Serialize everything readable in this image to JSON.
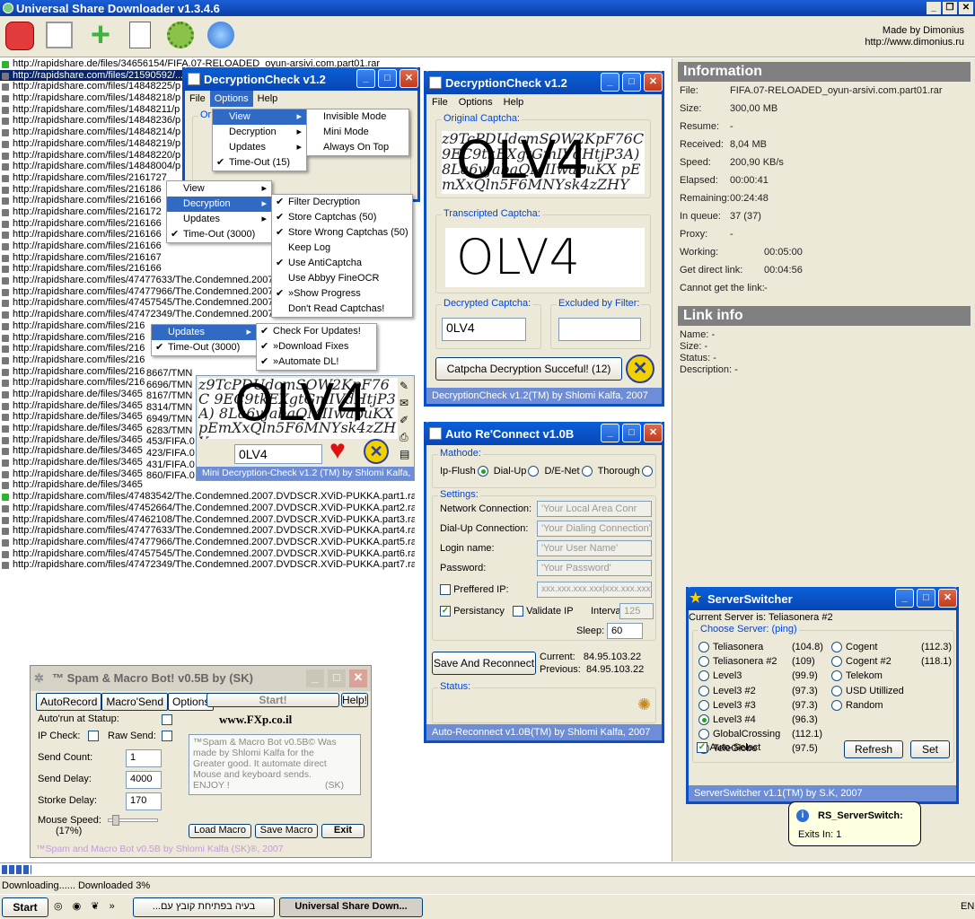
{
  "app": {
    "title": "Universal Share Downloader v1.3.4.6",
    "made_by": "Made by Dimonius",
    "url": "http://www.dimonius.ru"
  },
  "toolbar": {
    "icons": [
      "stop-icon",
      "window-icon",
      "add-icon",
      "document-icon",
      "gear-icon",
      "globe-icon"
    ]
  },
  "list": {
    "rows": [
      "http://rapidshare.de/files/34656154/FIFA.07-RELOADED_oyun-arsivi.com.part01.rar",
      "http://rapidshare.com/files/21590592/...",
      "http://rapidshare.com/files/14848225/p",
      "http://rapidshare.com/files/14848218/p",
      "http://rapidshare.com/files/14848211/p",
      "http://rapidshare.com/files/14848236/p",
      "http://rapidshare.com/files/14848214/p",
      "http://rapidshare.com/files/14848219/p",
      "http://rapidshare.com/files/14848220/p",
      "http://rapidshare.com/files/14848004/p",
      "http://rapidshare.com/files/2161727",
      "http://rapidshare.com/files/216186",
      "http://rapidshare.com/files/216166",
      "http://rapidshare.com/files/216172",
      "http://rapidshare.com/files/216166",
      "http://rapidshare.com/files/216166",
      "http://rapidshare.com/files/216166",
      "http://rapidshare.com/files/216167",
      "http://rapidshare.com/files/216166",
      "http://rapidshare.com/files/47477633/The.Condemned.2007.",
      "http://rapidshare.com/files/47477966/The.Condemned.2007.",
      "http://rapidshare.com/files/47457545/The.Condemned.2007.",
      "http://rapidshare.com/files/47472349/The.Condemned.2007.",
      "http://rapidshare.com/files/216",
      "http://rapidshare.com/files/216",
      "http://rapidshare.com/files/216",
      "http://rapidshare.com/files/216",
      "http://rapidshare.com/files/216",
      "http://rapidshare.com/files/216",
      "http://rapidshare.de/files/3465",
      "http://rapidshare.de/files/3465",
      "http://rapidshare.de/files/3465",
      "http://rapidshare.de/files/3465",
      "http://rapidshare.de/files/3465",
      "http://rapidshare.de/files/3465",
      "http://rapidshare.de/files/3465",
      "http://rapidshare.de/files/3465",
      "http://rapidshare.de/files/3465",
      "http://rapidshare.com/files/47483542/The.Condemned.2007.DVDSCR.XViD-PUKKA.part1.rar",
      "http://rapidshare.com/files/47452664/The.Condemned.2007.DVDSCR.XViD-PUKKA.part2.rar",
      "http://rapidshare.com/files/47462108/The.Condemned.2007.DVDSCR.XViD-PUKKA.part3.rar",
      "http://rapidshare.com/files/47477633/The.Condemned.2007.DVDSCR.XViD-PUKKA.part4.rar",
      "http://rapidshare.com/files/47477966/The.Condemned.2007.DVDSCR.XViD-PUKKA.part5.rar",
      "http://rapidshare.com/files/47457545/The.Condemned.2007.DVDSCR.XViD-PUKKA.part6.rar",
      "http://rapidshare.com/files/47472349/The.Condemned.2007.DVDSCR.XViD-PUKKA.part7.rar"
    ],
    "peek": [
      "8667/TMN",
      "6696/TMN",
      "8167/TMN",
      "8314/TMN",
      "6949/TMN",
      "6283/TMN",
      "453/FIFA.0",
      "423/FIFA.0",
      "431/FIFA.0",
      "860/FIFA.0"
    ]
  },
  "info": {
    "title": "Information",
    "rows": [
      {
        "k": "File:",
        "v": "FIFA.07-RELOADED_oyun-arsivi.com.part01.rar"
      },
      {
        "k": "Size:",
        "v": "300,00 MB"
      },
      {
        "k": "Resume:",
        "v": "-"
      },
      {
        "k": "Received:",
        "v": "8,04 MB"
      },
      {
        "k": "Speed:",
        "v": "200,90 KB/s"
      },
      {
        "k": "Elapsed:",
        "v": "00:00:41"
      },
      {
        "k": "Remaining:",
        "v": "00:24:48"
      },
      {
        "k": "In queue:",
        "v": "37 (37)"
      },
      {
        "k": "Proxy:",
        "v": "-"
      },
      {
        "k": "Working:",
        "v": "00:05:00"
      },
      {
        "k": "Get direct link:",
        "v": "00:04:56"
      },
      {
        "k": "Cannot get the link:",
        "v": "-"
      }
    ]
  },
  "linkinfo": {
    "title": "Link info",
    "rows": [
      "Name: -",
      "Size: -",
      "Status: -",
      "Description: -"
    ]
  },
  "status": {
    "text": "Downloading...... Downloaded 3%",
    "progress": 0.03
  },
  "taskbar": {
    "start": "Start",
    "task1": "...בעיה בפתיחת קובץ עם",
    "task2": "Universal Share Down...",
    "lang": "EN"
  },
  "dc_small": {
    "title": "DecryptionCheck v1.2",
    "menubar": [
      "File",
      "Options",
      "Help"
    ],
    "group": "Or",
    "options_menu": [
      {
        "label": "View",
        "sub": true
      },
      {
        "label": "Decryption",
        "sub": true
      },
      {
        "label": "Updates",
        "sub": true
      },
      {
        "label": "Time-Out (15)",
        "check": true
      }
    ],
    "view_menu": [
      "Invisible Mode",
      "Mini Mode",
      "Always On Top"
    ],
    "ctx_menu": [
      {
        "label": "View",
        "sub": true
      },
      {
        "label": "Decryption",
        "sub": true
      },
      {
        "label": "Updates",
        "sub": true
      },
      {
        "label": "Time-Out (3000)",
        "check": true
      }
    ],
    "dec_menu": [
      {
        "label": "Filter Decryption",
        "check": true
      },
      {
        "label": "Store Captchas (50)",
        "check": true
      },
      {
        "label": "Store Wrong Captchas (50)",
        "check": true
      },
      {
        "label": "Keep Log",
        "check": false
      },
      {
        "label": "Use AntiCaptcha",
        "check": true
      },
      {
        "label": "Use Abbyy FineOCR",
        "check": false
      },
      {
        "label": "»Show Progress",
        "check": true
      },
      {
        "label": "Don't Read Captchas!",
        "check": false
      }
    ],
    "ctx2_menu": [
      {
        "label": "Updates",
        "sub": true
      },
      {
        "label": "Time-Out (3000)",
        "check": true
      }
    ],
    "upd_menu": [
      {
        "label": "Check For Updates!",
        "check": true
      },
      {
        "label": "»Download Fixes",
        "check": true
      },
      {
        "label": "»Automate DL!",
        "check": true
      }
    ]
  },
  "mini": {
    "noise": "z9TcPDUdcmSOW2KpF76C 9EC9tkEXgtGmIVdHtjP3A) 8La6vJabaQMIIwapuKX pEmXxQln5F6MNYsk4zZHY",
    "big": "OLV4",
    "value": "0LV4",
    "footer": "Mini Decryption-Check v1.2 (TM) by Shlomi Kalfa, 2007"
  },
  "dc_big": {
    "title": "DecryptionCheck v1.2",
    "menubar": [
      "File",
      "Options",
      "Help"
    ],
    "orig_label": "Original Captcha:",
    "trans_label": "Transcripted Captcha:",
    "dec_label": "Decrypted Captcha:",
    "exc_label": "Excluded by Filter:",
    "dec_value": "0LV4",
    "exc_value": "",
    "trans_text": "OLV4",
    "button": "Catpcha Decryption Succeful!  (12)",
    "footer": "DecryptionCheck v1.2(TM) by Shlomi Kalfa, 2007"
  },
  "arc": {
    "title": "Auto Re'Connect v1.0B",
    "method_label": "Mathode:",
    "methods": [
      {
        "label": "Ip-Flush",
        "on": true
      },
      {
        "label": "Dial-Up",
        "on": false
      },
      {
        "label": "D/E-Net",
        "on": false
      },
      {
        "label": "Thorough",
        "on": false
      }
    ],
    "settings_label": "Settings:",
    "fields": [
      {
        "label": "Network Connection:",
        "value": "'Your Local Area Conr"
      },
      {
        "label": "Dial-Up Connection:",
        "value": "'Your Dialing Connection'"
      },
      {
        "label": "Login name:",
        "value": "'Your User Name'"
      },
      {
        "label": "Password:",
        "value": "'Your Password'"
      }
    ],
    "pref_ip": "Preffered IP:",
    "pref_ip_value": "xxx.xxx.xxx.xxx|xxx.xxx.xxx",
    "persistancy": "Persistancy",
    "validate": "Validate IP",
    "interval_label": "Interval:",
    "interval": "125",
    "sleep_label": "Sleep:",
    "sleep": "60",
    "save_btn": "Save And Reconnect",
    "current": "Current:   84.95.103.22",
    "previous": "Previous:  84.95.103.22",
    "status_label": "Status:",
    "footer": "Auto-Reconnect v1.0B(TM) by Shlomi Kalfa, 2007"
  },
  "ss": {
    "title": "ServerSwitcher",
    "current": "Current Server is: Teliasonera #2",
    "choose": "Choose Server: (ping)",
    "left": [
      {
        "n": "Teliasonera",
        "p": "(104.8)",
        "on": false
      },
      {
        "n": "Teliasonera #2",
        "p": "(109)",
        "on": false
      },
      {
        "n": "Level3",
        "p": "(99.9)",
        "on": false
      },
      {
        "n": "Level3 #2",
        "p": "(97.3)",
        "on": false
      },
      {
        "n": "Level3 #3",
        "p": "(97.3)",
        "on": false
      },
      {
        "n": "Level3 #4",
        "p": "(96.3)",
        "on": true
      },
      {
        "n": "GlobalCrossing",
        "p": "(112.1)",
        "on": false
      },
      {
        "n": "TeleGlobe",
        "p": "(97.5)",
        "on": false
      }
    ],
    "right": [
      {
        "n": "Cogent",
        "p": "(112.3)"
      },
      {
        "n": "Cogent #2",
        "p": "(118.1)"
      },
      {
        "n": "Telekom",
        "p": ""
      },
      {
        "n": "USD Utillized",
        "p": ""
      },
      {
        "n": "Random",
        "p": ""
      }
    ],
    "auto": "Auto-Select",
    "refresh": "Refresh",
    "set": "Set",
    "footer": "ServerSwitcher v1.1(TM) by S.K, 2007",
    "tip_title": "RS_ServerSwitch:",
    "tip_text": "Exits In: 1"
  },
  "spam": {
    "title": "™ Spam & Macro Bot! v0.5B by (SK)",
    "tabs": [
      "AutoRecord",
      "Macro'Send",
      "Options"
    ],
    "start": "Start!",
    "help": "Help!",
    "autorun": "Auto'run at Statup:",
    "ipcheck": "IP Check:",
    "rawsend": "Raw Send:",
    "site": "www.FXp.co.il",
    "rows": [
      {
        "k": "Send Count:",
        "v": "1"
      },
      {
        "k": "Send Delay:",
        "v": "4000"
      },
      {
        "k": "Storke Delay:",
        "v": "170"
      }
    ],
    "mouse": "Mouse Speed:",
    "mouse_pct": "(17%)",
    "desc": "™Spam & Macro Bot v0.5B© Was made by Shlomi Kalfa for the Greater good. It automate direct Mouse and keyboard sends. ENJOY !",
    "desc_sk": "(SK)",
    "load": "Load Macro",
    "save": "Save Macro",
    "exit": "Exit",
    "footer": "™Spam and Macro Bot v0.5B by Shlomi Kalfa (SK)®, 2007"
  }
}
